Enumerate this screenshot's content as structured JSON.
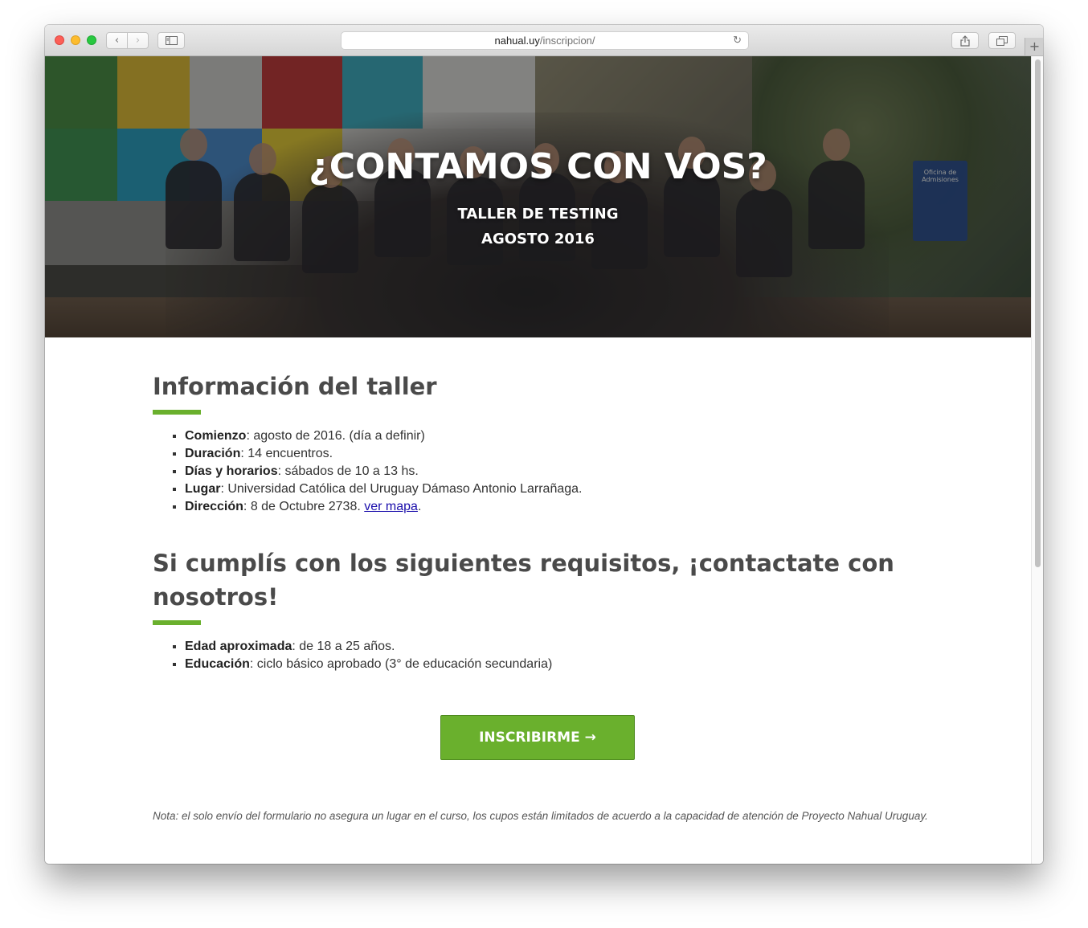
{
  "browser": {
    "url_domain": "nahual.uy",
    "url_path": "/inscripcion/",
    "back_glyph": "‹",
    "forward_glyph": "›",
    "reload_glyph": "↻",
    "new_tab_glyph": "+"
  },
  "hero": {
    "title": "¿CONTAMOS CON VOS?",
    "subtitle_line1": "TALLER DE TESTING",
    "subtitle_line2": "AGOSTO 2016",
    "sign_text": "Oficina de Admisiones"
  },
  "workshop_info": {
    "heading": "Información del taller",
    "items": [
      {
        "label": "Comienzo",
        "text": ": agosto de 2016. (día a definir)"
      },
      {
        "label": "Duración",
        "text": ": 14 encuentros."
      },
      {
        "label": "Días y horarios",
        "text": ": sábados de 10 a 13 hs."
      },
      {
        "label": "Lugar",
        "text": ": Universidad Católica del Uruguay Dámaso Antonio Larrañaga."
      },
      {
        "label": "Dirección",
        "text": ": 8 de Octubre 2738. ",
        "link": "ver mapa",
        "after": "."
      }
    ]
  },
  "requirements": {
    "heading": "Si cumplís con los siguientes requisitos, ¡contactate con nosotros!",
    "items": [
      {
        "label": "Edad aproximada",
        "text": ": de 18 a 25 años."
      },
      {
        "label": "Educación",
        "text": ": ciclo básico aprobado (3° de educación secundaria)"
      }
    ]
  },
  "cta": {
    "label": "INSCRIBIRME →"
  },
  "note": "Nota: el solo envío del formulario no asegura un lugar en el curso, los cupos están limitados de acuerdo a la capacidad de atención de Proyecto Nahual Uruguay.",
  "colors": {
    "accent": "#6ab02d",
    "heading": "#4a4a4a",
    "link": "#1a0dab"
  }
}
